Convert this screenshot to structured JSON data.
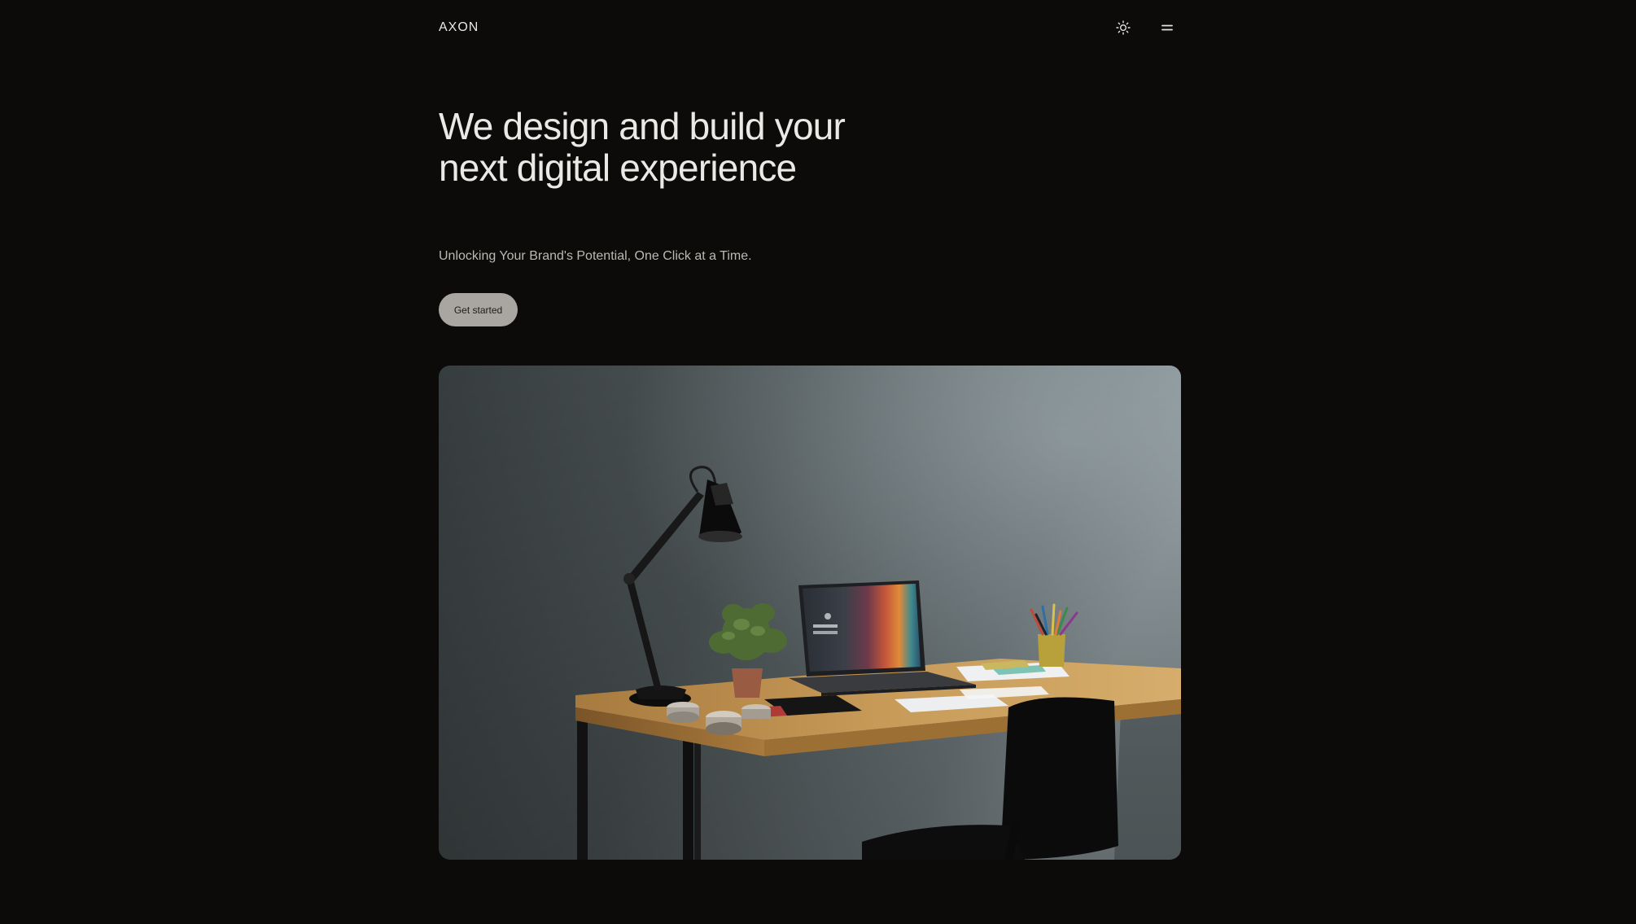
{
  "header": {
    "logo_text": "AXON",
    "theme_toggle_icon": "sun-icon",
    "menu_icon": "menu-icon"
  },
  "hero": {
    "title": "We design and build your next digital experience",
    "subtitle": "Unlocking Your Brand's Potential, One Click at a Time.",
    "cta_label": "Get started"
  },
  "colors": {
    "background": "#0c0b0a",
    "text": "#ebe9e6",
    "muted_text": "#bdb9b4",
    "button_bg": "#a9a5a0",
    "button_text": "#1e1d1b"
  }
}
